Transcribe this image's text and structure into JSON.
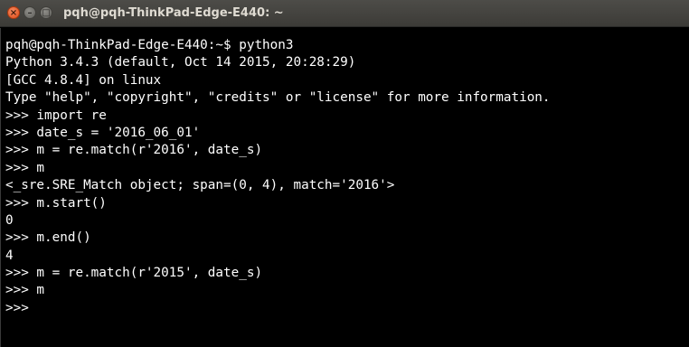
{
  "window": {
    "title": "pqh@pqh-ThinkPad-Edge-E440: ~",
    "close_glyph": "×",
    "minimize_glyph": "–",
    "maximize_glyph": "□"
  },
  "terminal": {
    "lines": [
      "pqh@pqh-ThinkPad-Edge-E440:~$ python3",
      "Python 3.4.3 (default, Oct 14 2015, 20:28:29)",
      "[GCC 4.8.4] on linux",
      "Type \"help\", \"copyright\", \"credits\" or \"license\" for more information.",
      ">>> import re",
      ">>> date_s = '2016_06_01'",
      ">>> m = re.match(r'2016', date_s)",
      ">>> m",
      "<_sre.SRE_Match object; span=(0, 4), match='2016'>",
      ">>> m.start()",
      "0",
      ">>> m.end()",
      "4",
      ">>> m = re.match(r'2015', date_s)",
      ">>> m",
      ">>> "
    ]
  },
  "colors": {
    "background": "#000000",
    "text": "#ffffff",
    "titlebar": "#3c3b37",
    "close_button": "#df4b16"
  }
}
